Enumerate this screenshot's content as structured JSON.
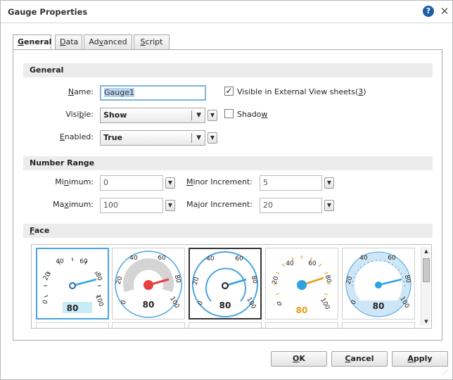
{
  "window": {
    "title": "Gauge Properties"
  },
  "tabs": [
    {
      "pre": "",
      "ul": "G",
      "post": "eneral"
    },
    {
      "pre": "",
      "ul": "D",
      "post": "ata"
    },
    {
      "pre": "Ad",
      "ul": "v",
      "post": "anced"
    },
    {
      "pre": "",
      "ul": "S",
      "post": "cript"
    }
  ],
  "general": {
    "heading": "General",
    "name_label": {
      "pre": "",
      "ul": "N",
      "post": "ame:"
    },
    "name_value": "Gauge1",
    "visible_label": {
      "pre": "Visi",
      "ul": "b",
      "post": "le:"
    },
    "visible_value": "Show",
    "enabled_label": {
      "pre": "",
      "ul": "E",
      "post": "nabled:"
    },
    "enabled_value": "True",
    "external_view": {
      "checked": true,
      "pre": "Visible in External View sheets(",
      "ul": "3",
      "post": ")"
    },
    "shadow": {
      "checked": false,
      "pre": "Shado",
      "ul": "w",
      "post": ""
    }
  },
  "number_range": {
    "heading": "Number Range",
    "minimum_label": {
      "pre": "Mi",
      "ul": "n",
      "post": "imum:"
    },
    "minimum_value": "0",
    "maximum_label": {
      "pre": "Ma",
      "ul": "x",
      "post": "imum:"
    },
    "maximum_value": "100",
    "minor_label": {
      "pre": "",
      "ul": "M",
      "post": "inor Increment:"
    },
    "minor_value": "5",
    "major_label": {
      "pre": "Ma",
      "ul": "j",
      "post": "or Increment:"
    },
    "major_value": "20"
  },
  "face": {
    "heading": {
      "pre": "",
      "ul": "F",
      "post": "ace"
    },
    "gauges": [
      {
        "style": "boxed",
        "value": "80",
        "ticks": [
          "0",
          "20",
          "40",
          "60",
          "80",
          "100"
        ]
      },
      {
        "style": "gray-red",
        "value": "80",
        "ticks": [
          "0",
          "20",
          "40",
          "60",
          "80",
          "100"
        ]
      },
      {
        "style": "ring-blue",
        "value": "80",
        "ticks": [
          "0",
          "20",
          "40",
          "60",
          "80",
          "100"
        ]
      },
      {
        "style": "orange",
        "value": "80",
        "ticks": [
          "0",
          "20",
          "40",
          "60",
          "80",
          "100"
        ]
      },
      {
        "style": "light-blue",
        "value": "80",
        "ticks": [
          "0",
          "20",
          "40",
          "60",
          "80",
          "100"
        ]
      }
    ]
  },
  "buttons": {
    "ok": {
      "pre": "",
      "ul": "O",
      "post": "K"
    },
    "cancel": {
      "pre": "",
      "ul": "C",
      "post": "ancel"
    },
    "apply": {
      "pre": "",
      "ul": "A",
      "post": "pply"
    }
  },
  "colors": {
    "accent_blue": "#4aa3df",
    "needle_red": "#e8403f",
    "orange": "#e89a1c",
    "help_blue": "#1d5fa6"
  }
}
